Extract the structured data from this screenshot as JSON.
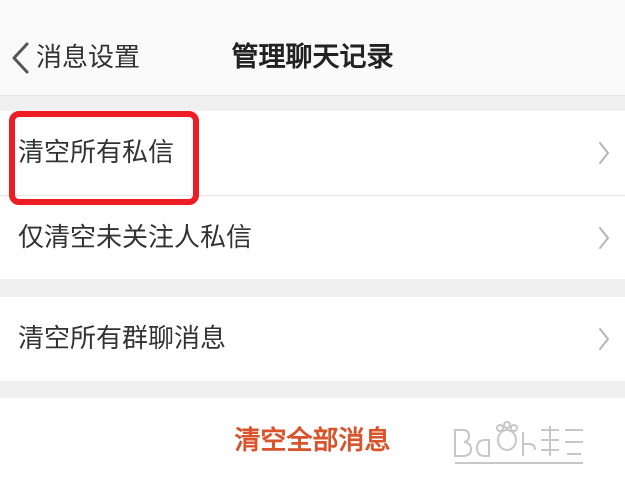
{
  "header": {
    "back_label": "消息设置",
    "title": "管理聊天记录",
    "back_icon": "chevron-left-icon"
  },
  "groups": [
    {
      "items": [
        {
          "label": "清空所有私信",
          "icon": "chevron-right-icon"
        },
        {
          "label": "仅清空未关注人私信",
          "icon": "chevron-right-icon"
        }
      ]
    },
    {
      "items": [
        {
          "label": "清空所有群聊消息",
          "icon": "chevron-right-icon"
        }
      ]
    }
  ],
  "footer": {
    "clear_all_label": "清空全部消息"
  },
  "colors": {
    "accent": "#d9532b",
    "highlight": "#ee1c24",
    "background": "#f0f0f0"
  }
}
